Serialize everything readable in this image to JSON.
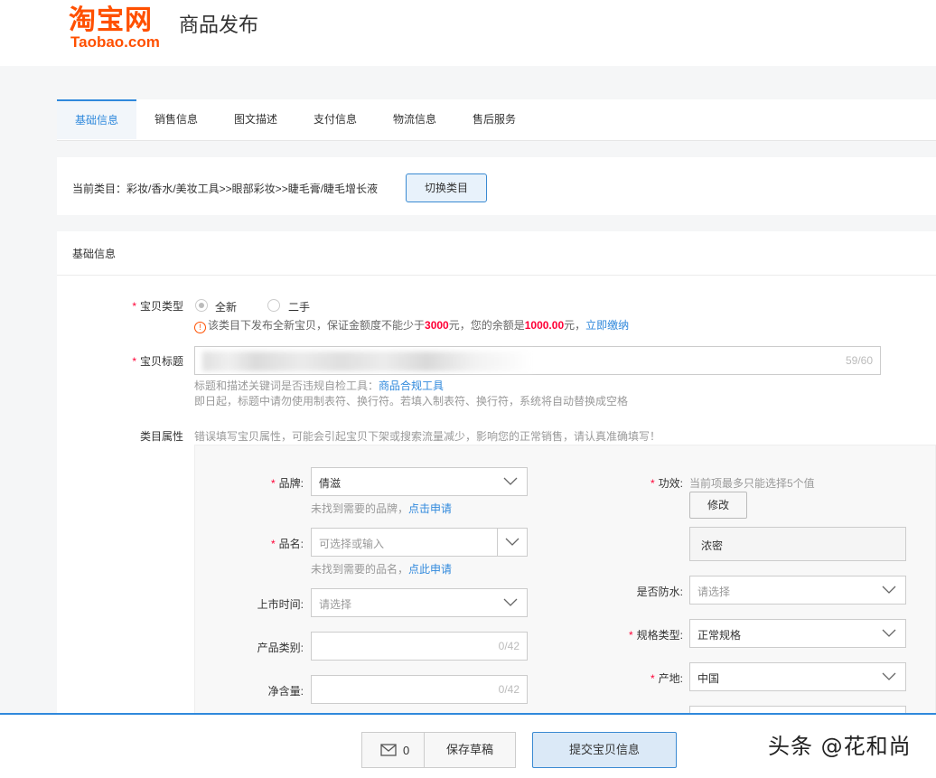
{
  "header": {
    "logo_cn": "淘宝网",
    "logo_en": "Taobao.com",
    "title": "商品发布"
  },
  "tabs": [
    {
      "label": "基础信息",
      "active": true
    },
    {
      "label": "销售信息"
    },
    {
      "label": "图文描述"
    },
    {
      "label": "支付信息"
    },
    {
      "label": "物流信息"
    },
    {
      "label": "售后服务"
    }
  ],
  "category": {
    "text": "当前类目：彩妆/香水/美妆工具>>眼部彩妆>>睫毛膏/睫毛增长液",
    "switch_label": "切换类目"
  },
  "basic": {
    "section_title": "基础信息",
    "item_type": {
      "label": "宝贝类型",
      "options": [
        "全新",
        "二手"
      ],
      "selected": "全新",
      "notice_pre": "该类目下发布全新宝贝，保证金额度不能少于",
      "amount": "3000",
      "notice_mid": "元，您的余额是",
      "balance": "1000.00",
      "notice_post": "元，",
      "pay_link": "立即缴纳"
    },
    "item_title": {
      "label": "宝贝标题",
      "counter": "59/60",
      "hint1_pre": "标题和描述关键词是否违规自检工具：",
      "hint1_link": "商品合规工具",
      "hint2": "即日起，标题中请勿使用制表符、换行符。若填入制表符、换行符，系统将自动替换成空格"
    },
    "attrs": {
      "label": "类目属性",
      "warning": "错误填写宝贝属性，可能会引起宝贝下架或搜索流量减少，影响您的正常销售，请认真准确填写！",
      "brand": {
        "label": "品牌:",
        "value": "倩滋",
        "hint": "未找到需要的品牌，",
        "link": "点击申请"
      },
      "product_name": {
        "label": "品名:",
        "placeholder": "可选择或输入",
        "hint": "未找到需要的品名，",
        "link": "点此申请"
      },
      "launch_time": {
        "label": "上市时间:",
        "placeholder": "请选择"
      },
      "product_type": {
        "label": "产品类别:",
        "counter": "0/42"
      },
      "net_content": {
        "label": "净含量:",
        "counter": "0/42"
      },
      "effect": {
        "label": "功效:",
        "hint": "当前项最多只能选择5个值",
        "modify": "修改",
        "value": "浓密"
      },
      "waterproof": {
        "label": "是否防水:",
        "placeholder": "请选择"
      },
      "spec_type": {
        "label": "规格类型:",
        "value": "正常规格"
      },
      "origin": {
        "label": "产地:",
        "value": "中国"
      }
    }
  },
  "footer": {
    "mail_count": "0",
    "save_label": "保存草稿",
    "submit_label": "提交宝贝信息"
  },
  "watermark": "头条 @花和尚",
  "colors": {
    "brand": "#ff5000",
    "accent": "#3089dc",
    "required": "#ff0036"
  }
}
